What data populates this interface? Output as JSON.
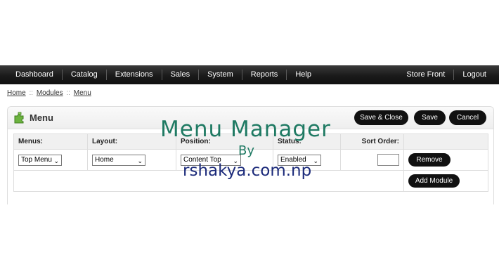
{
  "nav": {
    "left": [
      "Dashboard",
      "Catalog",
      "Extensions",
      "Sales",
      "System",
      "Reports",
      "Help"
    ],
    "right": [
      "Store Front",
      "Logout"
    ]
  },
  "breadcrumb": [
    "Home",
    "Modules",
    "Menu"
  ],
  "breadcrumb_sep": "::",
  "heading": {
    "title": "Menu",
    "icon": "module-puzzle-icon",
    "buttons": {
      "save_close": "Save & Close",
      "save": "Save",
      "cancel": "Cancel"
    }
  },
  "table": {
    "headers": {
      "menus": "Menus:",
      "layout": "Layout:",
      "position": "Position:",
      "status": "Status:",
      "sort": "Sort Order:"
    },
    "row": {
      "menus": "Top Menu",
      "layout": "Home",
      "position": "Content Top",
      "status": "Enabled",
      "sort_order": "",
      "remove": "Remove"
    },
    "add_module": "Add Module"
  },
  "watermark": {
    "title": "Menu  Manager",
    "by": "By",
    "site": "rshakya.com.np"
  },
  "colors": {
    "navbar": "#1a1a1a",
    "button": "#111111",
    "watermark_title": "#1f7a63",
    "watermark_site": "#1b2a7a"
  }
}
